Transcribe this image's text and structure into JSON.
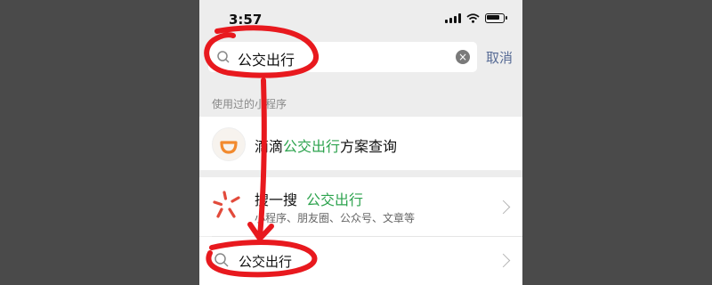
{
  "status_bar": {
    "time": "3:57"
  },
  "search": {
    "query": "公交出行",
    "clear_glyph": "×",
    "cancel_label": "取消"
  },
  "section": {
    "label": "使用过的小程序"
  },
  "used_mini_program": {
    "name_prefix": "滴滴",
    "name_highlight": "公交出行",
    "name_suffix": "方案查询",
    "logo_icon": "didi-logo"
  },
  "sou_yi_sou": {
    "title": "搜一搜",
    "keyword": "公交出行",
    "description": "小程序、朋友圈、公众号、文章等",
    "icon": "sou-yi-sou-icon"
  },
  "suggestion": {
    "text": "公交出行",
    "icon": "search-icon"
  },
  "annotation": {
    "color": "#e8191e"
  },
  "colors": {
    "highlight": "#2da34e",
    "cancel": "#576b95",
    "background": "#ededed"
  }
}
